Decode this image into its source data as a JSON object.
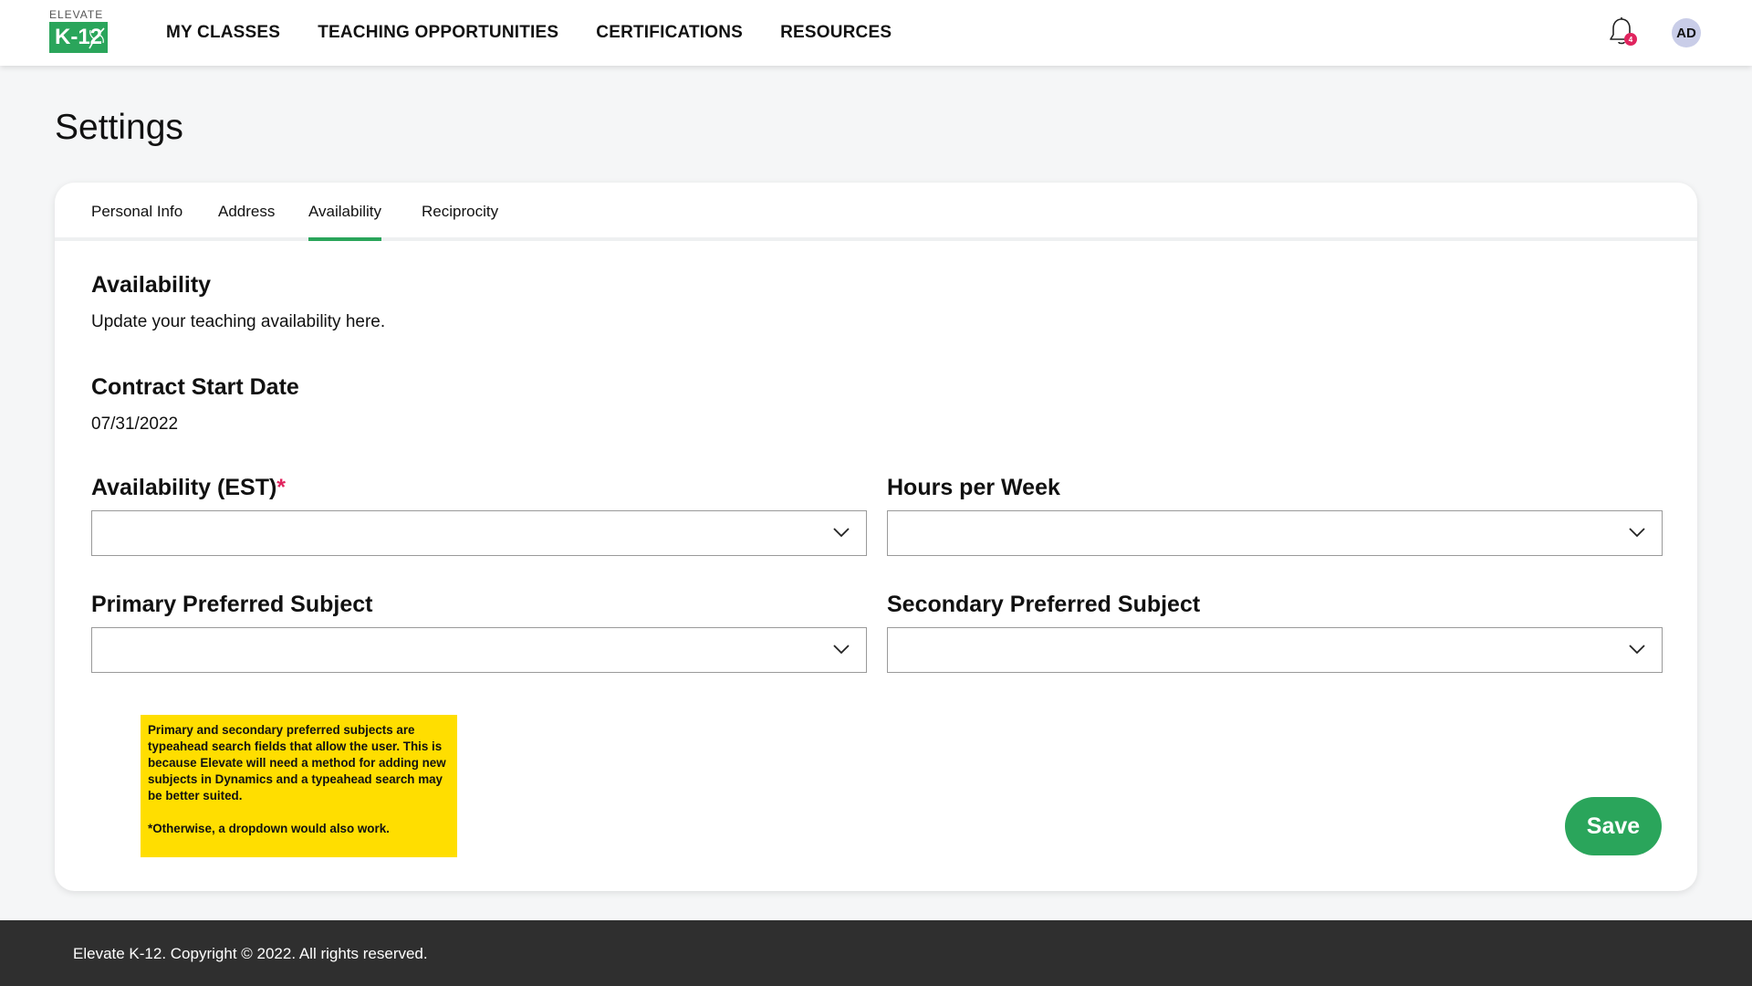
{
  "header": {
    "logo_word": "ELEVATE",
    "logo_mark": "K-12",
    "nav": [
      "MY CLASSES",
      "TEACHING OPPORTUNITIES",
      "CERTIFICATIONS",
      "RESOURCES"
    ],
    "notification_count": "4",
    "avatar_initials": "AD",
    "icons": {
      "notifications": "bell-icon"
    }
  },
  "page": {
    "title": "Settings"
  },
  "tabs": [
    "Personal Info",
    "Address",
    "Availability",
    "Reciprocity"
  ],
  "active_tab": "Availability",
  "availability": {
    "title": "Availability",
    "description": "Update your teaching availability here.",
    "contract_label": "Contract Start Date",
    "contract_value": "07/31/2022"
  },
  "fields": {
    "availability_est": {
      "label": "Availability (EST)",
      "required_mark": "*",
      "value": ""
    },
    "hours_per_week": {
      "label": "Hours per Week",
      "value": ""
    },
    "primary_subject": {
      "label": "Primary Preferred Subject",
      "value": ""
    },
    "secondary_subject": {
      "label": "Secondary Preferred Subject",
      "value": ""
    }
  },
  "note": {
    "text1": "Primary and secondary preferred subjects are typeahead search fields that allow the user. This is because Elevate will need a method for adding new subjects in Dynamics and a typeahead search may be better suited.",
    "text2": "*Otherwise, a dropdown would also work."
  },
  "actions": {
    "save_label": "Save"
  },
  "footer": {
    "text": "Elevate K-12. Copyright © 2022. All rights reserved."
  },
  "colors": {
    "brand_green": "#2aa55b",
    "required_red": "#e0245e",
    "note_yellow": "#ffde00",
    "footer_bg": "#2f2f2f"
  }
}
